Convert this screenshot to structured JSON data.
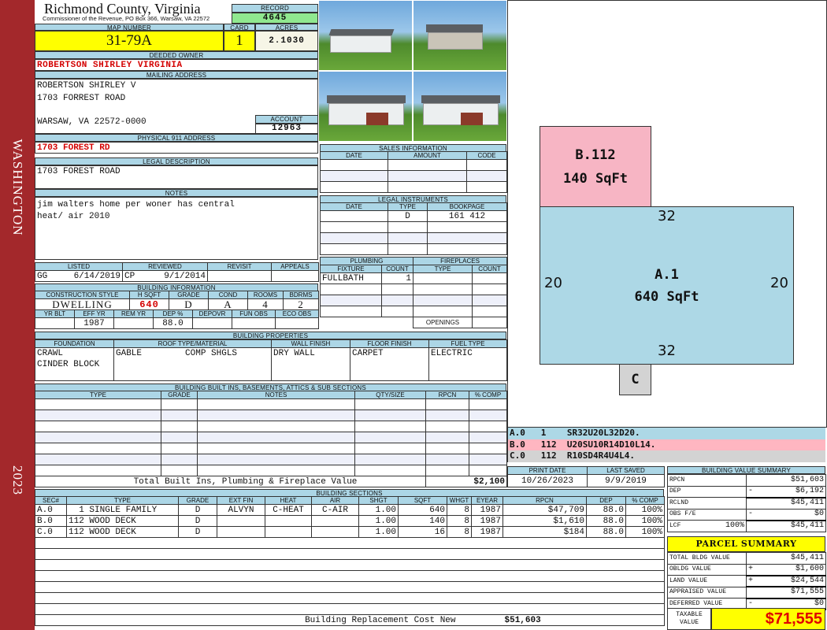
{
  "band": {
    "top": "WASHINGTON",
    "bottom": "2023"
  },
  "header": {
    "title": "Richmond County, Virginia",
    "subtitle": "Commissioner of the Revenue, PO Box 366, Warsaw, VA 22572",
    "record_label": "RECORD",
    "record": "4645"
  },
  "map": {
    "map_label": "MAP NUMBER",
    "map_number": "31-79A",
    "card_label": "CARD",
    "card": "1",
    "acres_label": "ACRES",
    "acres": "2.1030"
  },
  "owner": {
    "label": "DEEDED OWNER",
    "name": "ROBERTSON SHIRLEY VIRGINIA"
  },
  "mailing": {
    "label": "MAILING ADDRESS",
    "line1": "ROBERTSON SHIRLEY V",
    "line2": "1703 FORREST ROAD",
    "line3": "WARSAW, VA 22572-0000",
    "account_label": "ACCOUNT",
    "account": "12963"
  },
  "physical": {
    "label": "PHYSICAL 911 ADDRESS",
    "value": "1703 FOREST RD"
  },
  "legal": {
    "label": "LEGAL DESCRIPTION",
    "value": "1703 FOREST ROAD"
  },
  "notes": {
    "label": "NOTES",
    "line1": "jim walters home per woner has central",
    "line2": "heat/ air 2010"
  },
  "listed": {
    "listed_label": "LISTED",
    "listed_by": "GG",
    "listed_date": "6/14/2019",
    "reviewed_label": "REVIEWED",
    "reviewed_by": "CP",
    "reviewed_date": "9/1/2014",
    "revisit_label": "REVISIT",
    "appeals_label": "APPEALS"
  },
  "building_info": {
    "label": "BUILDING INFORMATION",
    "headers1": [
      "CONSTRUCTION STYLE",
      "H SQFT",
      "GRADE",
      "COND",
      "ROOMS",
      "BDRMS"
    ],
    "values1": [
      "DWELLING",
      "640",
      "D",
      "A",
      "4",
      "2"
    ],
    "headers2": [
      "YR BLT",
      "EFF YR",
      "REM YR",
      "DEP %",
      "DEPOVR",
      "FUN OBS",
      "ECO OBS"
    ],
    "values2": [
      "",
      "1987",
      "",
      "88.0",
      "",
      "",
      ""
    ]
  },
  "sales": {
    "label": "SALES INFORMATION",
    "headers": [
      "DATE",
      "AMOUNT",
      "CODE"
    ]
  },
  "legal_instruments": {
    "label": "LEGAL INSTRUMENTS",
    "headers": [
      "DATE",
      "TYPE",
      "BOOKPAGE"
    ],
    "row": {
      "date": "",
      "type": "D",
      "bookpage": "161 412"
    }
  },
  "plumbing": {
    "label": "PLUMBING",
    "headers": [
      "FIXTURE",
      "COUNT"
    ],
    "fixture": "FULLBATH",
    "count": "1"
  },
  "fireplaces": {
    "label": "FIREPLACES",
    "headers": [
      "TYPE",
      "COUNT"
    ],
    "openings_label": "OPENINGS"
  },
  "properties": {
    "label": "BUILDING PROPERTIES",
    "headers": [
      "FOUNDATION",
      "ROOF TYPE/MATERIAL",
      "WALL FINISH",
      "FLOOR FINISH",
      "FUEL TYPE"
    ],
    "foundation1": "CRAWL",
    "foundation2": "CINDER BLOCK",
    "roof_type": "GABLE",
    "roof_material": "COMP SHGLS",
    "wall": "DRY WALL",
    "floor": "CARPET",
    "fuel": "ELECTRIC"
  },
  "builtins": {
    "label": "BUILDING BUILT INS, BASEMENTS, ATTICS & SUB SECTIONS",
    "headers": [
      "TYPE",
      "GRADE",
      "NOTES",
      "QTY/SIZE",
      "RPCN",
      "% COMP"
    ],
    "total_label": "Total Built Ins, Plumbing & Fireplace Value",
    "total": "$2,100"
  },
  "sections": {
    "label": "BUILDING SECTIONS",
    "headers": [
      "SEC#",
      "TYPE",
      "GRADE",
      "EXT FIN",
      "HEAT",
      "AIR",
      "SHGT",
      "SQFT",
      "WHGT",
      "EYEAR",
      "RPCN",
      "DEP",
      "% COMP"
    ],
    "rows": [
      [
        "A.0",
        "  1 SINGLE FAMILY",
        "D",
        "ALVYN",
        "C-HEAT",
        "C-AIR",
        "1.00",
        "640",
        "8",
        "1987",
        "$47,709",
        "88.0",
        "100%"
      ],
      [
        "B.0",
        "112 WOOD DECK",
        "D",
        "",
        "",
        "",
        "1.00",
        "140",
        "8",
        "1987",
        "$1,610",
        "88.0",
        "100%"
      ],
      [
        "C.0",
        "112 WOOD DECK",
        "D",
        "",
        "",
        "",
        "1.00",
        "16",
        "8",
        "1987",
        "$184",
        "88.0",
        "100%"
      ]
    ],
    "replacement_label": "Building Replacement Cost New",
    "replacement": "$51,603"
  },
  "sketch": {
    "areas": [
      {
        "label": "B.112",
        "sqft": "140 SqFt",
        "color": "#f7b5c4"
      },
      {
        "label": "A.1",
        "sqft": "640 SqFt",
        "color": "#add8e6"
      },
      {
        "label": "C",
        "color": "#d3d3d3"
      }
    ],
    "dims": {
      "top": "32",
      "bottom": "32",
      "left": "20",
      "right": "20"
    },
    "legend": [
      {
        "text": "A.0   1    SR32U20L32D20.",
        "color": "#add8e6"
      },
      {
        "text": "B.0   112  U20SU10R14D10L14.",
        "color": "#ffb6c1"
      },
      {
        "text": "C.0   112  R10SD4R4U4L4.",
        "color": "#d3d3d3"
      }
    ]
  },
  "dates": {
    "print_label": "PRINT DATE",
    "print": "10/26/2023",
    "saved_label": "LAST SAVED",
    "saved": "9/9/2019"
  },
  "value_summary": {
    "label": "BUILDING VALUE SUMMARY",
    "rows": [
      {
        "k": "RPCN",
        "op": "",
        "v": "$51,603"
      },
      {
        "k": "DEP",
        "op": "-",
        "v": "$6,192"
      },
      {
        "k": "RCLND",
        "op": "",
        "v": "$45,411"
      },
      {
        "k": "OBS F/E",
        "op": "-",
        "v": "$0"
      },
      {
        "k": "LCF",
        "pct": "100%",
        "op": "",
        "v": "$45,411"
      }
    ]
  },
  "parcel": {
    "label": "PARCEL SUMMARY",
    "rows": [
      {
        "k": "TOTAL BLDG VALUE",
        "op": "",
        "v": "$45,411"
      },
      {
        "k": "OBLDG VALUE",
        "op": "+",
        "v": "$1,600"
      },
      {
        "k": "LAND VALUE",
        "op": "+",
        "v": "$24,544"
      },
      {
        "k": "APPRAISED VALUE",
        "op": "",
        "v": "$71,555"
      },
      {
        "k": "DEFERRED VALUE",
        "op": "-",
        "v": "$0"
      }
    ],
    "taxable_label": "TAXABLE VALUE",
    "taxable": "$71,555"
  }
}
